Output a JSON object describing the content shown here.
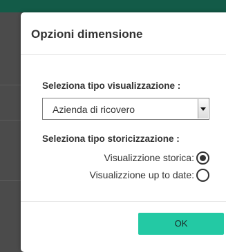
{
  "dialog": {
    "title": "Opzioni dimensione"
  },
  "visualization": {
    "label": "Seleziona tipo visualizzazione :",
    "selected_value": "Azienda di ricovero"
  },
  "history": {
    "label": "Seleziona tipo storicizzazione :",
    "options": [
      {
        "label": "Visualizzione storica:",
        "checked": true
      },
      {
        "label": "Visualizzione up to date:",
        "checked": false
      }
    ]
  },
  "footer": {
    "ok_label": "OK"
  },
  "colors": {
    "ok_button": "#23c9a4",
    "top_bar": "#135b48",
    "backdrop": "#4b4b4b"
  },
  "icons": {
    "select_arrow": "chevron-down-icon",
    "radio_checked": "radio-checked-icon",
    "radio_unchecked": "radio-unchecked-icon"
  }
}
